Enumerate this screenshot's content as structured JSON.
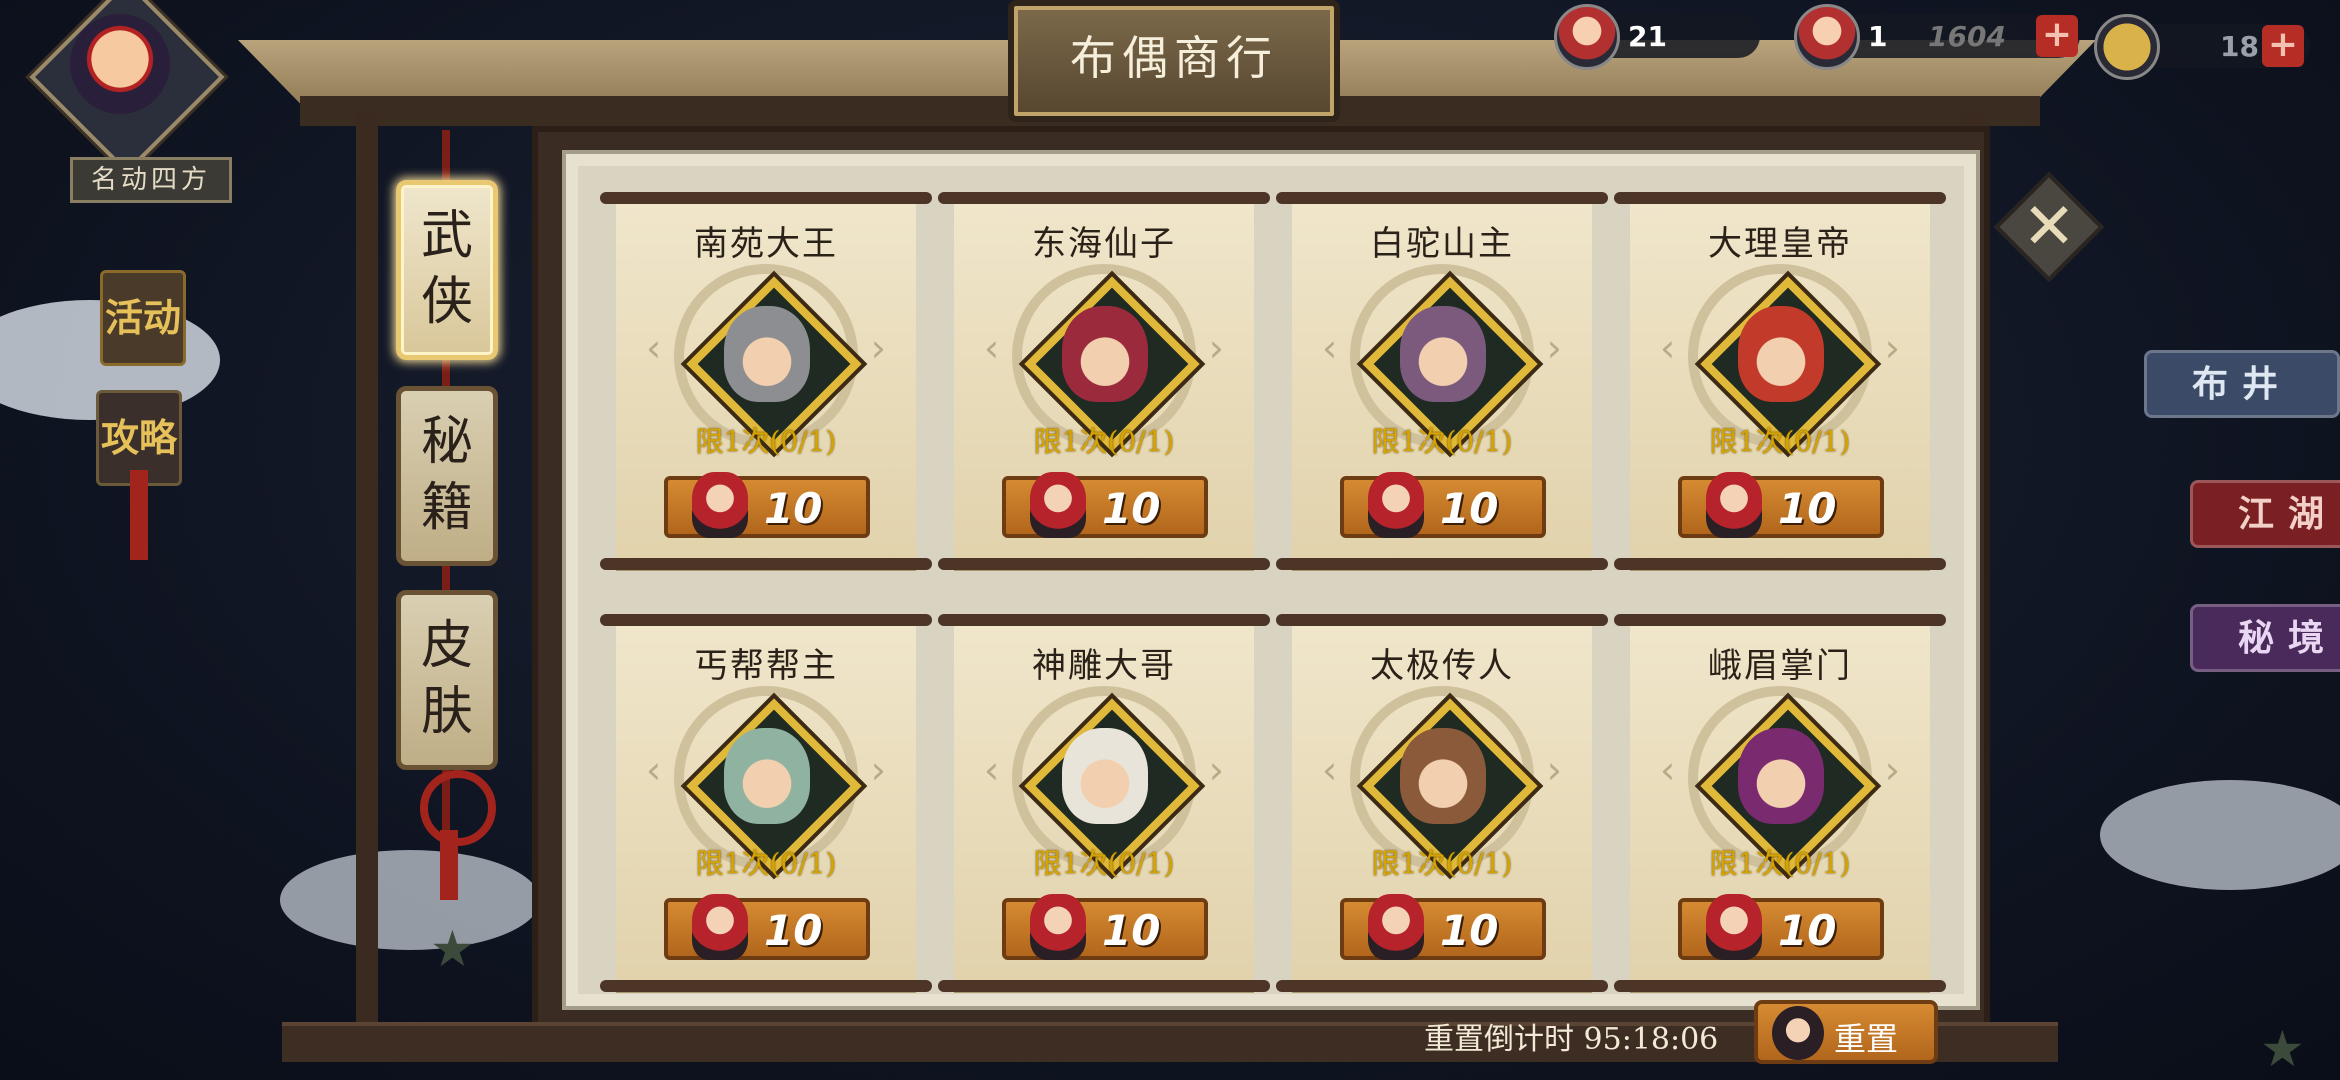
{
  "window": {
    "title": "布偶商行"
  },
  "currency": {
    "puppet_count": "21",
    "second_count": "1",
    "third_count": "1604",
    "gold_count": "18"
  },
  "player": {
    "title_plate": "名动四方"
  },
  "left_banners": {
    "activity": "活动",
    "guide": "攻略"
  },
  "tabs": [
    {
      "label_1": "武",
      "label_2": "侠",
      "active": true
    },
    {
      "label_1": "秘",
      "label_2": "籍",
      "active": false
    },
    {
      "label_1": "皮",
      "label_2": "肤",
      "active": false
    }
  ],
  "cards": [
    {
      "name": "南苑大王",
      "limit": "限1次(0/1)",
      "price": "10",
      "face_color": "#8d8e92"
    },
    {
      "name": "东海仙子",
      "limit": "限1次(0/1)",
      "price": "10",
      "face_color": "#9b2a3c"
    },
    {
      "name": "白驼山主",
      "limit": "限1次(0/1)",
      "price": "10",
      "face_color": "#7b5a7e"
    },
    {
      "name": "大理皇帝",
      "limit": "限1次(0/1)",
      "price": "10",
      "face_color": "#c23a2a"
    },
    {
      "name": "丐帮帮主",
      "limit": "限1次(0/1)",
      "price": "10",
      "face_color": "#8fb3a0"
    },
    {
      "name": "神雕大哥",
      "limit": "限1次(0/1)",
      "price": "10",
      "face_color": "#e9e4d9"
    },
    {
      "name": "太极传人",
      "limit": "限1次(0/1)",
      "price": "10",
      "face_color": "#8a5a3a"
    },
    {
      "name": "峨眉掌门",
      "limit": "限1次(0/1)",
      "price": "10",
      "face_color": "#7a2a6e"
    }
  ],
  "footer": {
    "countdown_label": "重置倒计时 95:18:06",
    "reset_label": "重置"
  },
  "right_menu": [
    {
      "label": "布井",
      "color": "#3b4a66",
      "text_color": "#dfe7f2"
    },
    {
      "label": "江湖",
      "color": "#7a1f22",
      "text_color": "#f2d0c8"
    },
    {
      "label": "秘境",
      "color": "#4a2a5a",
      "text_color": "#e8d6f2"
    }
  ],
  "icons": {
    "close": "close-icon",
    "price": "puppet-coin-icon"
  }
}
